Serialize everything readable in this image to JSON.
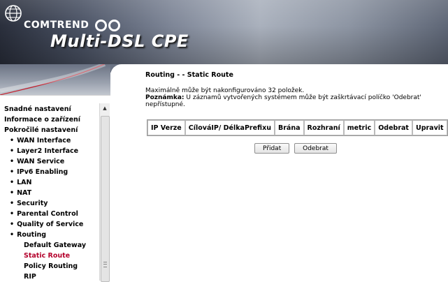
{
  "brand": {
    "name": "COMTREND",
    "product": "Multi-DSL CPE"
  },
  "sidebar": {
    "items": [
      {
        "label": "Snadné nastavení",
        "level": 0
      },
      {
        "label": "Informace o zařízení",
        "level": 0
      },
      {
        "label": "Pokročilé nastavení",
        "level": 0
      },
      {
        "label": "WAN Interface",
        "level": 1
      },
      {
        "label": "Layer2 Interface",
        "level": 1
      },
      {
        "label": "WAN Service",
        "level": 1
      },
      {
        "label": "IPv6 Enabling",
        "level": 1
      },
      {
        "label": "LAN",
        "level": 1
      },
      {
        "label": "NAT",
        "level": 1
      },
      {
        "label": "Security",
        "level": 1
      },
      {
        "label": "Parental Control",
        "level": 1
      },
      {
        "label": "Quality of Service",
        "level": 1
      },
      {
        "label": "Routing",
        "level": 1
      },
      {
        "label": "Default Gateway",
        "level": 2
      },
      {
        "label": "Static Route",
        "level": 2,
        "active": true
      },
      {
        "label": "Policy Routing",
        "level": 2
      },
      {
        "label": "RIP",
        "level": 2
      }
    ],
    "scroll_up_glyph": "▲",
    "active_color": "#b4002b"
  },
  "main": {
    "title": "Routing - - Static Route",
    "max_text": "Maximálně může být nakonfigurováno 32 položek.",
    "note_label": "Poznámka:",
    "note_text": " U záznamů vytvořených systémem může být zaškrtávací políčko 'Odebrat' nepřístupné.",
    "table": {
      "columns": [
        "IP Verze",
        "CílováIP/ DélkaPrefixu",
        "Brána",
        "Rozhraní",
        "metric",
        "Odebrat",
        "Upravit"
      ]
    },
    "buttons": {
      "add": "Přidat",
      "remove": "Odebrat"
    }
  }
}
